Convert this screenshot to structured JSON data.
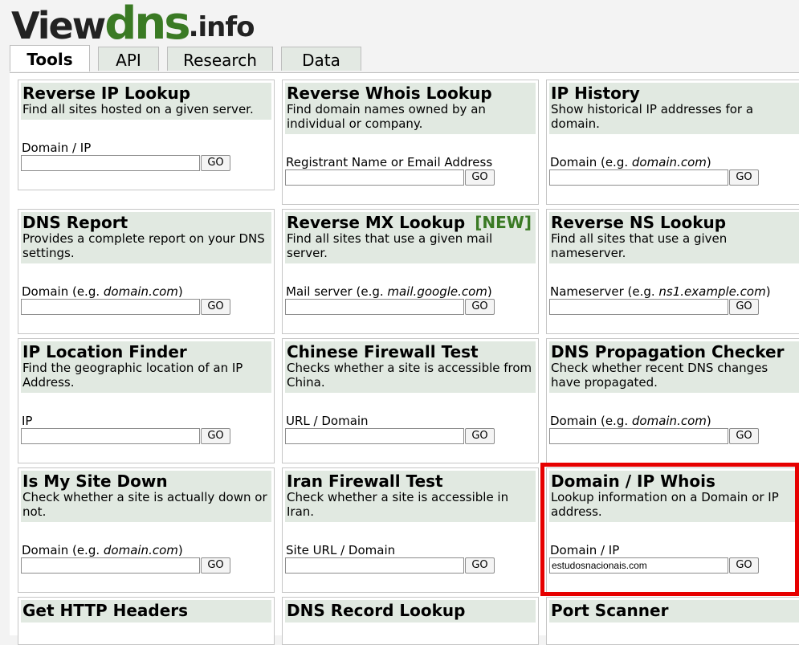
{
  "logo": {
    "part1": "View",
    "part2": "dns",
    "part3": ".info"
  },
  "tabs": [
    {
      "label": "Tools",
      "active": true
    },
    {
      "label": "API"
    },
    {
      "label": "Research"
    },
    {
      "label": "Data"
    }
  ],
  "tools": [
    {
      "title": "Reverse IP Lookup",
      "desc": "Find all sites hosted on a given server.",
      "label": "Domain / IP",
      "value": ""
    },
    {
      "title": "Reverse Whois Lookup",
      "desc": "Find domain names owned by an individual or company.",
      "label": "Registrant Name or Email Address",
      "value": ""
    },
    {
      "title": "IP History",
      "desc": "Show historical IP addresses for a domain.",
      "label_pre": "Domain (e.g. ",
      "label_em": "domain.com",
      "label_post": ")",
      "value": ""
    },
    {
      "title": "DNS Report",
      "desc": "Provides a complete report on your DNS settings.",
      "label_pre": "Domain (e.g. ",
      "label_em": "domain.com",
      "label_post": ")",
      "value": ""
    },
    {
      "title": "Reverse MX Lookup",
      "badge": "[NEW]",
      "desc": "Find all sites that use a given mail server.",
      "label_pre": "Mail server (e.g. ",
      "label_em": "mail.google.com",
      "label_post": ")",
      "value": ""
    },
    {
      "title": "Reverse NS Lookup",
      "desc": "Find all sites that use a given nameserver.",
      "label_pre": "Nameserver (e.g. ",
      "label_em": "ns1.example.com",
      "label_post": ")",
      "value": ""
    },
    {
      "title": "IP Location Finder",
      "desc": "Find the geographic location of an IP Address.",
      "label": "IP",
      "value": ""
    },
    {
      "title": "Chinese Firewall Test",
      "desc": "Checks whether a site is accessible from China.",
      "label": "URL / Domain",
      "value": ""
    },
    {
      "title": "DNS Propagation Checker",
      "desc": "Check whether recent DNS changes have propagated.",
      "label_pre": "Domain (e.g. ",
      "label_em": "domain.com",
      "label_post": ")",
      "value": ""
    },
    {
      "title": "Is My Site Down",
      "desc": "Check whether a site is actually down or not.",
      "label_pre": "Domain (e.g. ",
      "label_em": "domain.com",
      "label_post": ")",
      "value": ""
    },
    {
      "title": "Iran Firewall Test",
      "desc": "Check whether a site is accessible in Iran.",
      "label": "Site URL / Domain",
      "value": ""
    },
    {
      "title": "Domain / IP Whois",
      "desc": "Lookup information on a Domain or IP address.",
      "label": "Domain / IP",
      "value": "estudosnacionais.com"
    },
    {
      "title": "Get HTTP Headers"
    },
    {
      "title": "DNS Record Lookup"
    },
    {
      "title": "Port Scanner"
    }
  ],
  "go_label": "GO"
}
